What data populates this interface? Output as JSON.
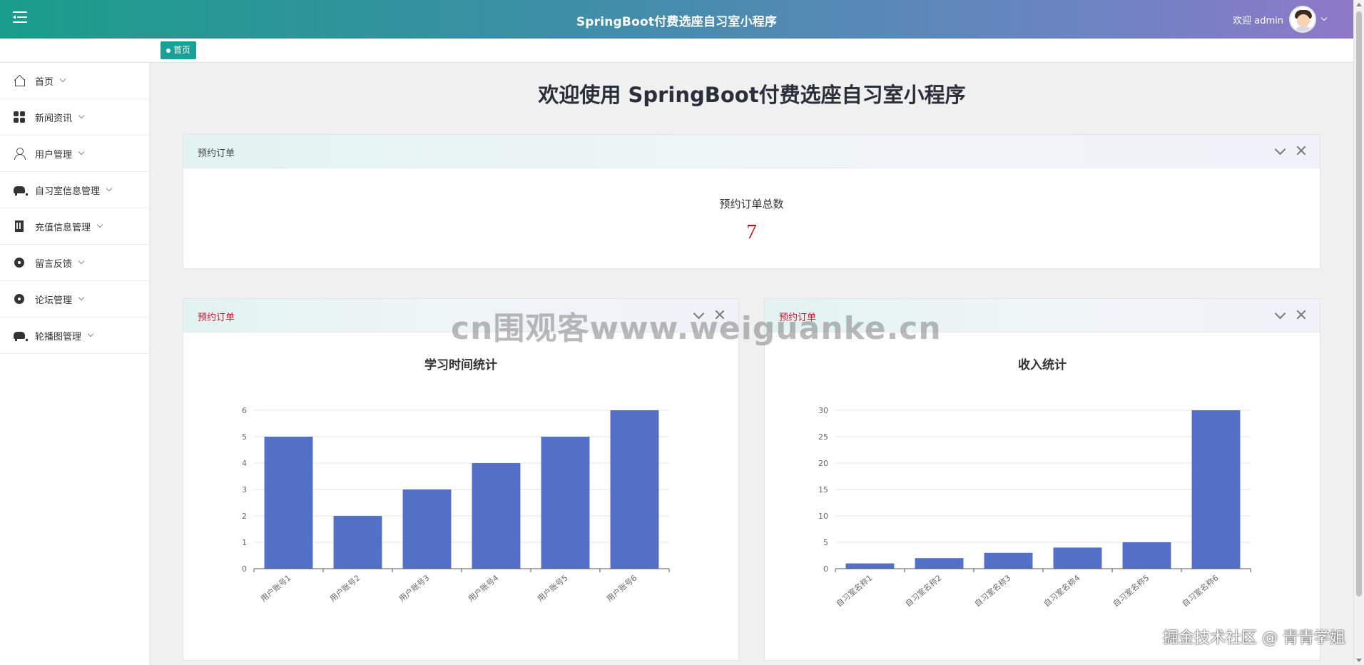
{
  "header": {
    "title": "SpringBoot付费选座自习室小程序",
    "welcome": "欢迎 admin"
  },
  "tabs": [
    {
      "label": "首页"
    }
  ],
  "sidebar": {
    "items": [
      {
        "label": "首页",
        "icon": "home-icon"
      },
      {
        "label": "新闻资讯",
        "icon": "grid-icon"
      },
      {
        "label": "用户管理",
        "icon": "user-icon"
      },
      {
        "label": "自习室信息管理",
        "icon": "car-icon"
      },
      {
        "label": "充值信息管理",
        "icon": "building-icon"
      },
      {
        "label": "留言反馈",
        "icon": "disc-icon"
      },
      {
        "label": "论坛管理",
        "icon": "disc-icon"
      },
      {
        "label": "轮播图管理",
        "icon": "car-icon"
      }
    ]
  },
  "main": {
    "page_title": "欢迎使用 SpringBoot付费选座自习室小程序",
    "summary_card": {
      "header": "预约订单",
      "stat_label": "预约订单总数",
      "stat_value": "7"
    },
    "left_card": {
      "header": "预约订单"
    },
    "right_card": {
      "header": "预约订单"
    }
  },
  "watermark": "cn围观客www.weiguanke.cn",
  "corner_mark": "掘金技术社区 @ 青青学姐",
  "colors": {
    "accent": "#1aa094",
    "bar": "#5470c6",
    "stat_value": "#b5121b"
  },
  "chart_data": [
    {
      "type": "bar",
      "title": "学习时间统计",
      "categories": [
        "用户账号1",
        "用户账号2",
        "用户账号3",
        "用户账号4",
        "用户账号5",
        "用户账号6"
      ],
      "values": [
        5,
        2,
        3,
        4,
        5,
        6
      ],
      "ylim": [
        0,
        6
      ],
      "yticks": [
        0,
        1,
        2,
        3,
        4,
        5,
        6
      ],
      "grid": true
    },
    {
      "type": "bar",
      "title": "收入统计",
      "categories": [
        "自习室名称1",
        "自习室名称2",
        "自习室名称3",
        "自习室名称4",
        "自习室名称5",
        "自习室名称6"
      ],
      "values": [
        1,
        2,
        3,
        4,
        5,
        30
      ],
      "ylim": [
        0,
        30
      ],
      "yticks": [
        0,
        5,
        10,
        15,
        20,
        25,
        30
      ],
      "grid": true
    }
  ]
}
